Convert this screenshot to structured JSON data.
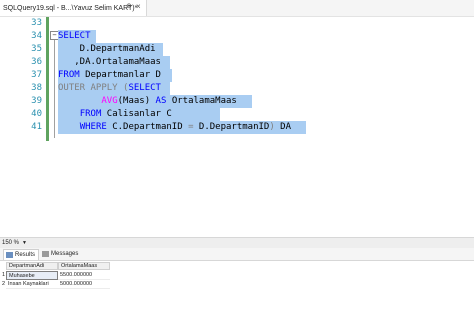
{
  "tab": {
    "title": "SQLQuery19.sql - B...\\Yavuz Selim KART)*",
    "pin": "⊕",
    "close": "×"
  },
  "gutter": {
    "line_numbers": [
      "33",
      "34",
      "35",
      "36",
      "37",
      "38",
      "39",
      "40",
      "41"
    ],
    "collapse_symbol": "−"
  },
  "code": {
    "l34": "SELECT",
    "l35": "    D.DepartmanAdi",
    "l36": "   ,DA.OrtalamaMaas",
    "l37_kw": "FROM",
    "l37_rest": " Departmanlar D",
    "l38_a": "OUTER APPLY",
    "l38_b": " (",
    "l38_c": "SELECT",
    "l39_pre": "        ",
    "l39_fn": "AVG",
    "l39_args": "(Maas)",
    "l39_as": " AS",
    "l39_rest": " OrtalamaMaas",
    "l40_pre": "    ",
    "l40_kw": "FROM",
    "l40_rest": " Calisanlar C",
    "l41_pre": "    ",
    "l41_kw": "WHERE",
    "l41_a": " C.DepartmanID ",
    "l41_eq": "=",
    "l41_b": " D.DepartmanID",
    "l41_paren": ")",
    "l41_c": " DA"
  },
  "status": {
    "zoom": "150 %",
    "zoom_arrow": "▼"
  },
  "results_tabs": [
    {
      "label": "Results"
    },
    {
      "label": "Messages"
    }
  ],
  "results": {
    "columns": [
      "DepartmanAdi",
      "OrtalamaMaas"
    ],
    "rows": [
      {
        "n": "1",
        "DepartmanAdi": "Muhasebe",
        "OrtalamaMaas": "5500.000000"
      },
      {
        "n": "2",
        "DepartmanAdi": "Insan Kaynaklari",
        "OrtalamaMaas": "5000.000000"
      }
    ]
  },
  "colors": {
    "keyword": "#0000ff",
    "function": "#ff00ff",
    "line_number": "#2b91af",
    "selection": "#a9cdf2",
    "gray": "#808080"
  }
}
